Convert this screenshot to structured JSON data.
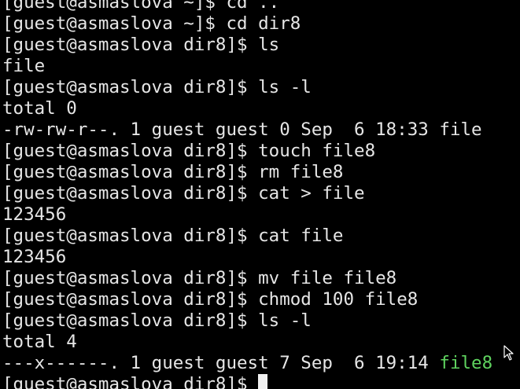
{
  "terminal": {
    "top_fragment": "[guest@asmaslova ~]$ cd ..",
    "lines": [
      "[guest@asmaslova ~]$ cd dir8",
      "[guest@asmaslova dir8]$ ls",
      "file",
      "[guest@asmaslova dir8]$ ls -l",
      "total 0",
      "-rw-rw-r--. 1 guest guest 0 Sep  6 18:33 file",
      "[guest@asmaslova dir8]$ touch file8",
      "[guest@asmaslova dir8]$ rm file8",
      "[guest@asmaslova dir8]$ cat > file",
      "123456",
      "[guest@asmaslova dir8]$ cat file",
      "123456",
      "[guest@asmaslova dir8]$ mv file file8",
      "[guest@asmaslova dir8]$ chmod 100 file8",
      "[guest@asmaslova dir8]$ ls -l",
      "total 4"
    ],
    "listing_line_prefix": "---x------. 1 guest guest 7 Sep  6 19:14 ",
    "listing_line_filename": "file8",
    "prompt": "[guest@asmaslova dir8]$ ",
    "filename_color": "#5fd35f",
    "text_color": "#e6e6e6",
    "background_color": "#000000",
    "pointer_icon": "mouse-pointer-icon"
  }
}
